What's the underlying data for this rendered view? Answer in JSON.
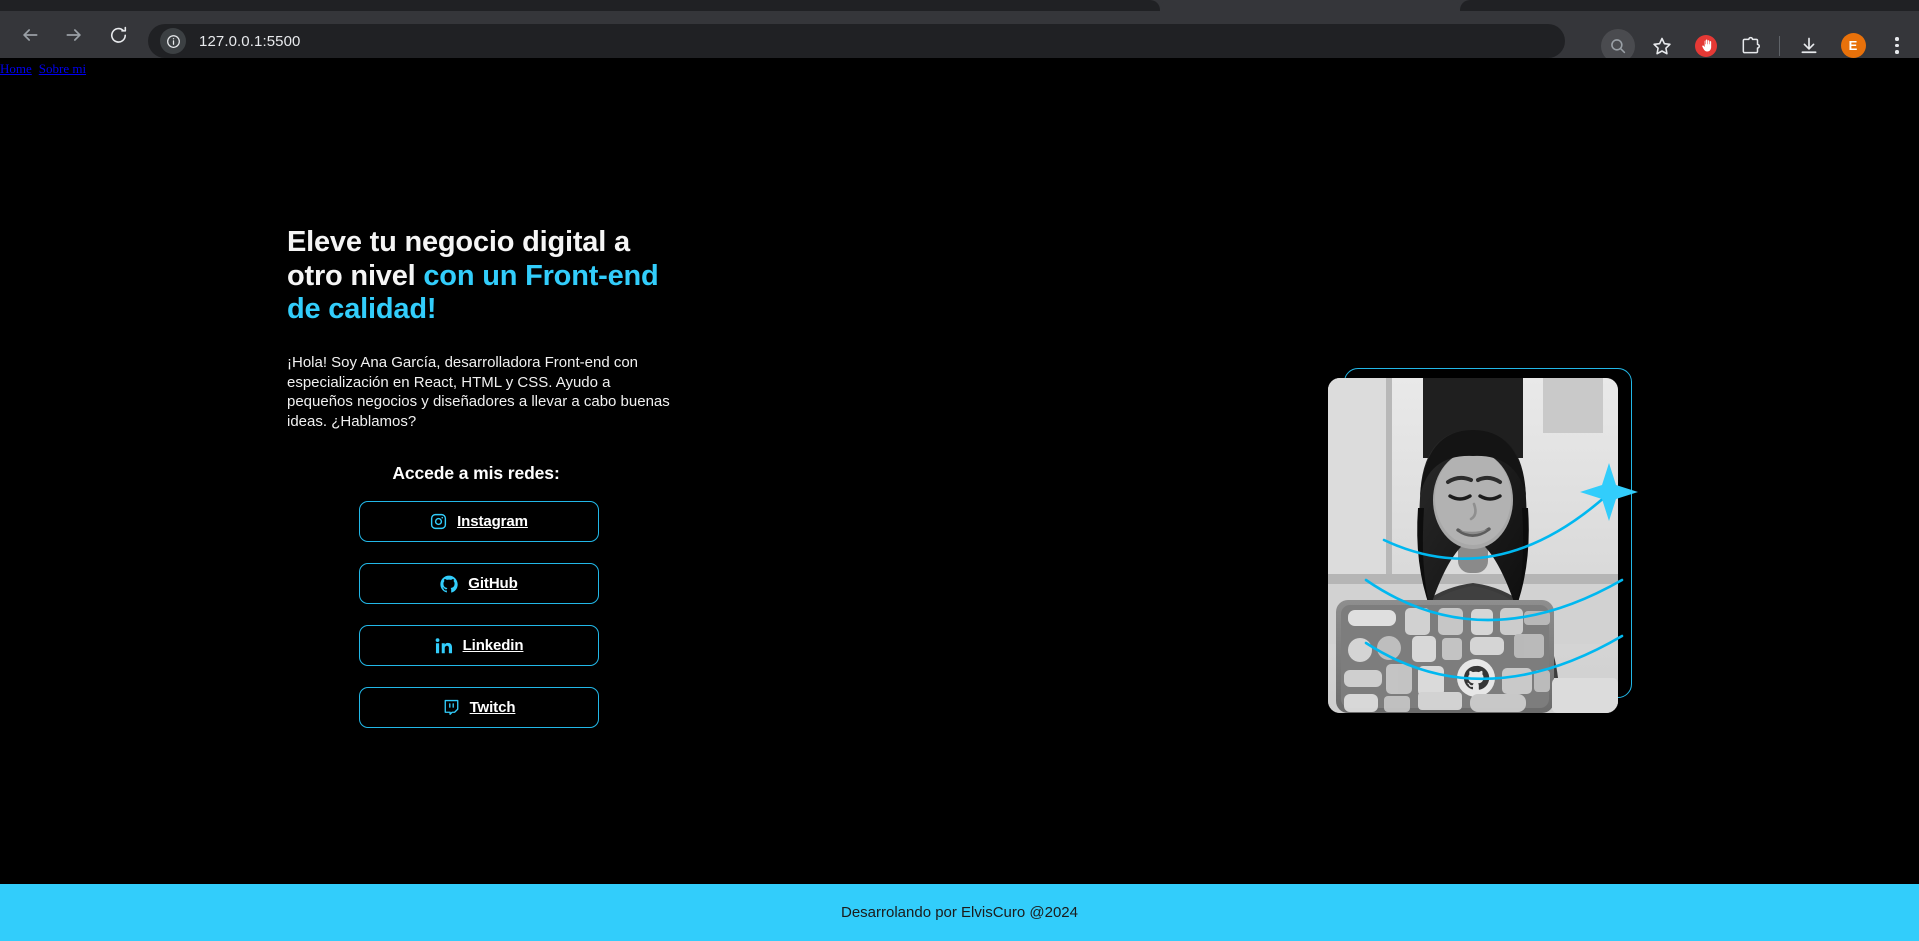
{
  "browser": {
    "url": "127.0.0.1:5500",
    "back_label": "Back",
    "forward_label": "Forward",
    "reload_label": "Reload",
    "site_info_label": "View site information",
    "zoom_label": "Zoom",
    "bookmark_label": "Bookmark this tab",
    "adblock_label": "AdBlock",
    "extensions_label": "Extensions",
    "downloads_label": "Downloads",
    "profile_initial": "E",
    "menu_label": "Customize and control Google Chrome"
  },
  "skip_nav": {
    "links": [
      {
        "label": "Home"
      },
      {
        "label": "Sobre mi"
      }
    ]
  },
  "hero": {
    "headline_plain_1": "Eleve tu negocio digital a otro nivel ",
    "headline_accent": "con un Front-end de calidad!",
    "lede": "¡Hola! Soy Ana García, desarrolladora Front-end con especialización en React, HTML y CSS. Ayudo a pequeños negocios y diseñadores a llevar a cabo buenas ideas. ¿Hablamos?",
    "redes_title": "Accede a mis redes:",
    "socials": [
      {
        "label": "Instagram",
        "icon": "instagram-icon"
      },
      {
        "label": "GitHub",
        "icon": "github-icon"
      },
      {
        "label": "Linkedin",
        "icon": "linkedin-icon"
      },
      {
        "label": "Twitch",
        "icon": "twitch-icon"
      }
    ],
    "photo_alt": "Desarrolladora sonriendo frente a una laptop con stickers"
  },
  "footer": {
    "text": "Desarrolando por ElvisCuro @2024"
  },
  "colors": {
    "accent": "#32cdfb",
    "border_accent": "#22b8e8",
    "background": "#000000",
    "text": "#ffffff",
    "footer_bg": "#32cdfb",
    "footer_text": "#1b1b1b"
  }
}
